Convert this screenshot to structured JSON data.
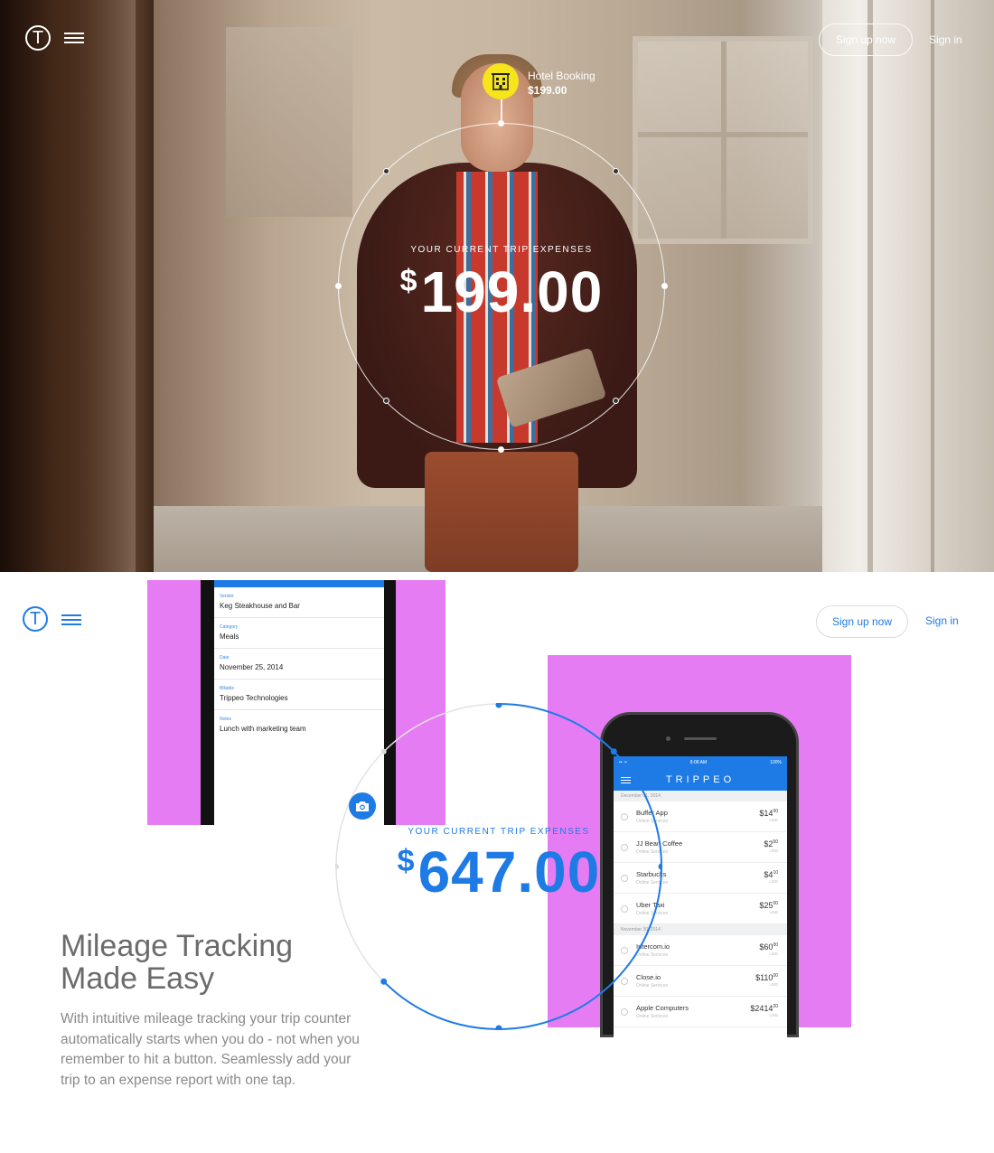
{
  "nav": {
    "logo_letter": "T",
    "signup_label": "Sign up now",
    "signin_label": "Sign in"
  },
  "hero": {
    "badge_title": "Hotel Booking",
    "badge_amount": "$199.00",
    "caption": "YOUR CURRENT TRIP EXPENSES",
    "currency": "$",
    "amount": "199.00"
  },
  "receipt_form": {
    "fields": [
      {
        "label": "Vendor",
        "value": "Keg Steakhouse and Bar"
      },
      {
        "label": "Category",
        "value": "Meals"
      },
      {
        "label": "Date",
        "value": "November 25, 2014"
      },
      {
        "label": "Billable",
        "value": "Trippeo Technologies"
      },
      {
        "label": "Notes",
        "value": "Lunch with marketing team"
      }
    ]
  },
  "app": {
    "time": "8:08 AM",
    "battery": "100%",
    "signal": "••••• ",
    "brand": "TRIPPEO",
    "sections": [
      {
        "date": "December 01, 2014",
        "items": [
          {
            "name": "Buffer App",
            "sub": "Online Services",
            "amount": "$14",
            "cents": "00",
            "unit": "USD"
          },
          {
            "name": "JJ Bean Coffee",
            "sub": "Online Services",
            "amount": "$2",
            "cents": "50",
            "unit": "USD"
          },
          {
            "name": "Starbucks",
            "sub": "Online Services",
            "amount": "$4",
            "cents": "10",
            "unit": "USD"
          },
          {
            "name": "Uber Taxi",
            "sub": "Online Services",
            "amount": "$25",
            "cents": "00",
            "unit": "USD"
          }
        ]
      },
      {
        "date": "November 30, 2014",
        "items": [
          {
            "name": "Intercom.io",
            "sub": "Online Services",
            "amount": "$60",
            "cents": "00",
            "unit": "USD"
          },
          {
            "name": "Close.io",
            "sub": "Online Services",
            "amount": "$110",
            "cents": "00",
            "unit": "USD"
          },
          {
            "name": "Apple Computers",
            "sub": "Online Services",
            "amount": "$2414",
            "cents": "20",
            "unit": "USD"
          }
        ]
      }
    ]
  },
  "section2": {
    "caption": "YOUR CURRENT TRIP EXPENSES",
    "currency": "$",
    "amount": "647.00",
    "headline_line1": "Mileage Tracking",
    "headline_line2": "Made Easy",
    "description": "With intuitive mileage tracking your trip counter automatically starts when you do - not when you remember to hit a button. Seamlessly add your trip to an expense report with one tap."
  },
  "colors": {
    "accent": "#1e7be6",
    "badge_yellow": "#f6e51b",
    "pink": "#e67cf3"
  }
}
